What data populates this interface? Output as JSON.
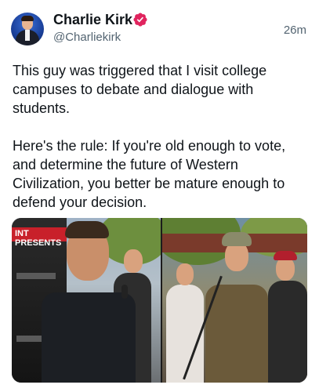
{
  "author": {
    "name": "Charlie Kirk",
    "handle": "@Charliekirk",
    "verified_color": "#e0245e",
    "avatar_icon": "profile-photo"
  },
  "time_ago": "26m",
  "tweet": {
    "paragraph_1": "This guy was triggered that I visit college campuses to debate and dialogue with students.",
    "paragraph_2": "Here's the rule: If you're old enough to vote, and determine the future of Western Civilization, you better be mature enough to defend your decision."
  },
  "media": {
    "banner_text": "INT PRESENTS"
  },
  "colors": {
    "text_primary": "#0f1419",
    "text_secondary": "#536471"
  }
}
